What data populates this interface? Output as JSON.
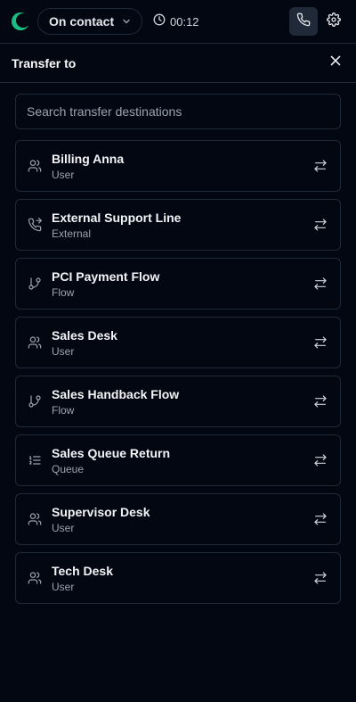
{
  "topbar": {
    "status_label": "On contact",
    "timer": "00:12",
    "logo_icon": "crescent-logo-icon",
    "accent_color": "#22c55e",
    "phone_icon": "phone-icon",
    "settings_icon": "gear-icon"
  },
  "panel": {
    "title": "Transfer to",
    "close_icon": "close-icon"
  },
  "search": {
    "placeholder": "Search transfer destinations",
    "value": ""
  },
  "destinations": [
    {
      "name": "Billing Anna",
      "type": "User",
      "icon": "users-icon"
    },
    {
      "name": "External Support Line",
      "type": "External",
      "icon": "phone-forward-icon"
    },
    {
      "name": "PCI Payment Flow",
      "type": "Flow",
      "icon": "git-branch-icon"
    },
    {
      "name": "Sales Desk",
      "type": "User",
      "icon": "users-icon"
    },
    {
      "name": "Sales Handback Flow",
      "type": "Flow",
      "icon": "git-branch-icon"
    },
    {
      "name": "Sales Queue Return",
      "type": "Queue",
      "icon": "list-ordered-icon"
    },
    {
      "name": "Supervisor Desk",
      "type": "User",
      "icon": "users-icon"
    },
    {
      "name": "Tech Desk",
      "type": "User",
      "icon": "users-icon"
    }
  ]
}
